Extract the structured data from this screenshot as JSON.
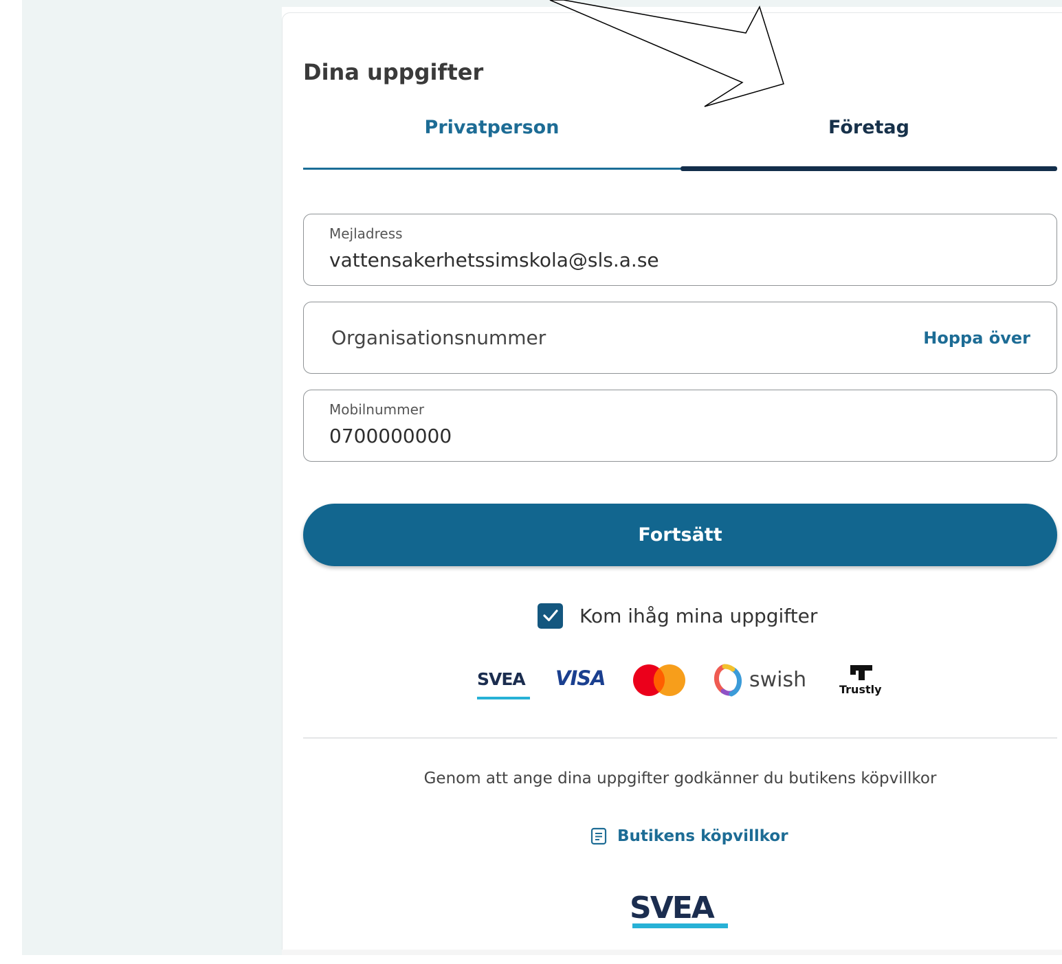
{
  "form": {
    "title": "Dina uppgifter",
    "tabs": [
      {
        "label": "Privatperson",
        "selected": false
      },
      {
        "label": "Företag",
        "selected": true
      }
    ],
    "email": {
      "label": "Mejladress",
      "value": "vattensakerhetssimskola@sls.a.se"
    },
    "org_number": {
      "placeholder": "Organisationsnummer",
      "skip_label": "Hoppa över"
    },
    "mobile": {
      "label": "Mobilnummer",
      "value": "0700000000"
    },
    "continue_label": "Fortsätt",
    "remember": {
      "label": "Kom ihåg mina uppgifter",
      "checked": true
    }
  },
  "payment_logos": {
    "svea": "SVEA",
    "visa": "VISA",
    "mastercard": "mastercard-logo",
    "swish": "swish",
    "trustly": "Trustly"
  },
  "footer": {
    "terms_text": "Genom att ange dina uppgifter godkänner du butikens köpvillkor",
    "terms_link": "Butikens köpvillkor",
    "brand": "SVEA"
  },
  "colors": {
    "primary": "#12668f",
    "tab_active_line": "#132e4b",
    "link": "#1d6c95",
    "accent_cyan": "#27b1d6"
  }
}
